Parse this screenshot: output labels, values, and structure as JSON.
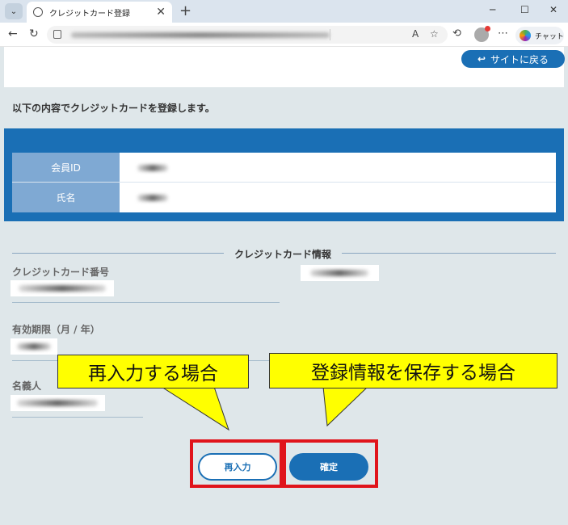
{
  "browser": {
    "tab_title": "クレジットカード登録",
    "new_tab_symbol": "+",
    "tab_close_symbol": "✕",
    "minimize_symbol": "─",
    "maximize_symbol": "☐",
    "close_symbol": "✕",
    "chat_label": "チャット"
  },
  "header": {
    "back_button_label": "サイトに戻る"
  },
  "intro_text": "以下の内容でクレジットカードを登録します。",
  "member_info": {
    "rows": [
      {
        "label": "会員ID"
      },
      {
        "label": "氏名"
      }
    ]
  },
  "card_info": {
    "section_title": "クレジットカード情報",
    "card_number_label": "クレジットカード番号",
    "expiry_label": "有効期限（月 / 年）",
    "holder_label": "名義人"
  },
  "callouts": {
    "reenter_note": "再入力する場合",
    "save_note": "登録情報を保存する場合"
  },
  "buttons": {
    "reenter_label": "再入力",
    "confirm_label": "確定"
  },
  "colors": {
    "accent_blue": "#1a6fb5",
    "callout_yellow": "#ffff00",
    "highlight_red": "#e0141b"
  }
}
